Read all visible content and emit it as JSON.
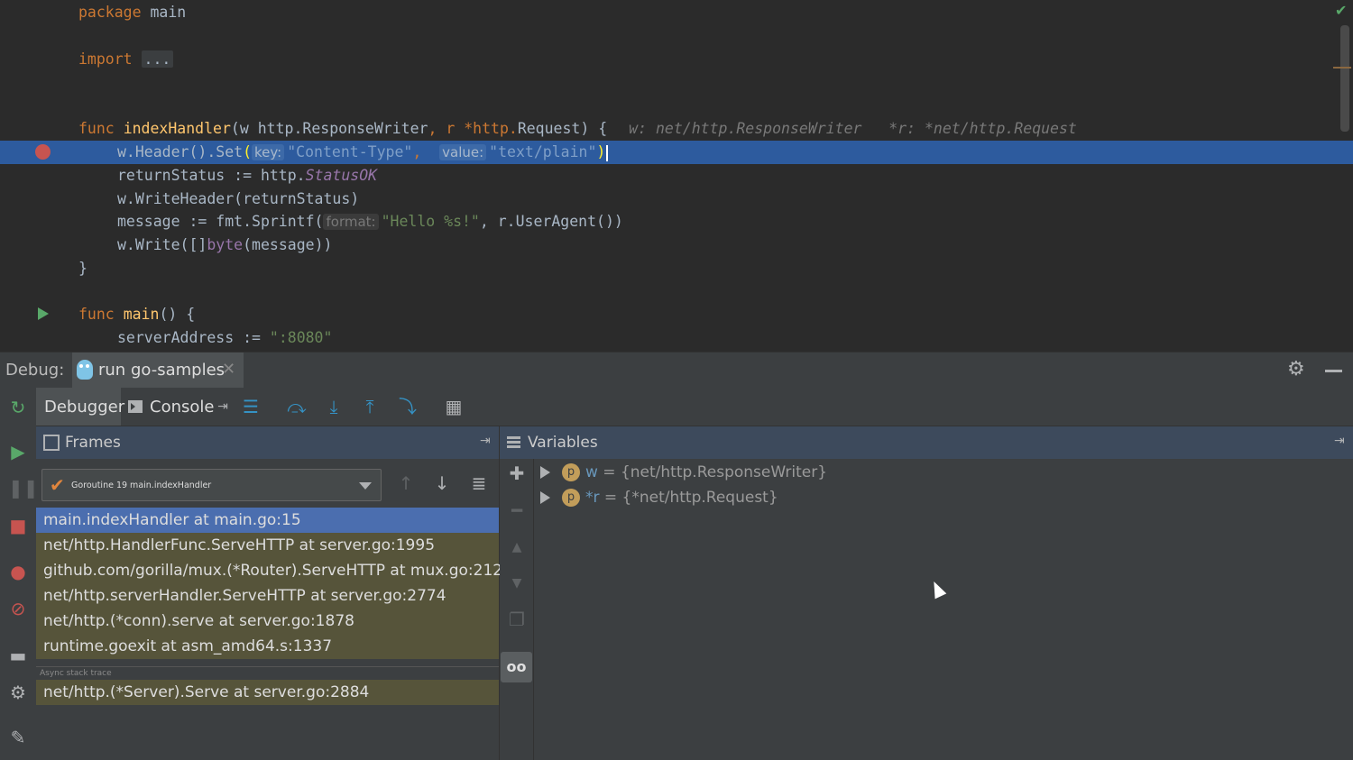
{
  "editor": {
    "lines": {
      "l1": {
        "kw": "package",
        "rest": " main"
      },
      "l2": {
        "kw": "import",
        "fold": "..."
      },
      "l3": {
        "kw": "func",
        "name": "indexHandler",
        "p1": "(w http.",
        "p2": "ResponseWriter",
        "p3": ", r *http.",
        "p4": "Request",
        "p5": ") {",
        "inline": "w: net/http.ResponseWriter   *r: *net/http.Request"
      },
      "l4": {
        "a": "w.Header().Set",
        "open": "(",
        "hint1": "key:",
        "s1": "\"Content-Type\"",
        "comma": ",  ",
        "hint2": "value:",
        "s2": "\"text/plain\"",
        "close": ")"
      },
      "l5": {
        "a": "returnStatus := http.",
        "c": "StatusOK"
      },
      "l6": {
        "a": "w.WriteHeader(returnStatus)"
      },
      "l7": {
        "a": "message := fmt.Sprintf(",
        "hint": "format:",
        "s": "\"Hello %s!\"",
        "b": ", r.UserAgent())"
      },
      "l8": {
        "a": "w.Write([]",
        "t": "byte",
        "b": "(message))"
      },
      "l9": {
        "a": "}"
      },
      "l10": {
        "kw": "func",
        "name": "main",
        "rest": "() {"
      },
      "l11": {
        "a": "serverAddress := ",
        "s": "\":8080\""
      }
    }
  },
  "debug": {
    "label": "Debug:",
    "run_tab": "run go-samples",
    "close_glyph": "✕",
    "tabs": {
      "debugger": "Debugger",
      "console": "Console"
    },
    "frames": {
      "title": "Frames",
      "thread": "Goroutine 19 main.indexHandler",
      "items": [
        "main.indexHandler at main.go:15",
        "net/http.HandlerFunc.ServeHTTP at server.go:1995",
        "github.com/gorilla/mux.(*Router).ServeHTTP at mux.go:212",
        "net/http.serverHandler.ServeHTTP at server.go:2774",
        "net/http.(*conn).serve at server.go:1878",
        "runtime.goexit at asm_amd64.s:1337"
      ],
      "async_label": "Async stack trace",
      "async_items": [
        "net/http.(*Server).Serve at server.go:2884"
      ]
    },
    "variables": {
      "title": "Variables",
      "items": [
        {
          "badge": "p",
          "name": "w",
          "value": " = {net/http.ResponseWriter}"
        },
        {
          "badge": "p",
          "name": "*r",
          "value": " = {*net/http.Request}"
        }
      ]
    }
  },
  "colors": {
    "accent": "#4b6eaf",
    "breakpoint": "#c75450",
    "keyword": "#cc7832",
    "string": "#6a8759"
  }
}
